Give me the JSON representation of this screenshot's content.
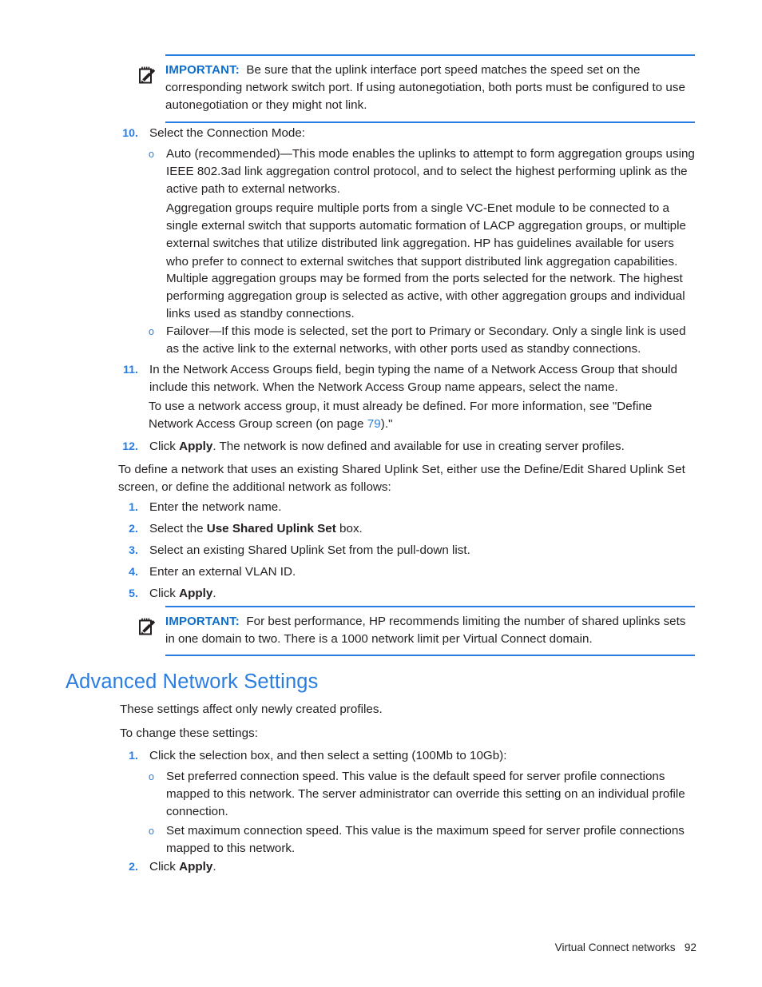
{
  "page": {
    "footer_text": "Virtual Connect networks",
    "footer_page_number": "92"
  },
  "colors": {
    "accent_blue": "#2a7de1",
    "important_blue": "#0d6ecd",
    "body_black": "#231f20"
  },
  "notes": [
    {
      "icon": "note-pencil-icon",
      "label": "IMPORTANT:",
      "text": "Be sure that the uplink interface port speed matches the speed set on the corresponding network switch port. If using autonegotiation, both ports must be configured to use autonegotiation or they might not link."
    },
    {
      "icon": "note-pencil-icon",
      "label": "IMPORTANT:",
      "text": "For best performance, HP recommends limiting the number of shared uplinks sets in one domain to two. There is a 1000 network limit per Virtual Connect domain."
    }
  ],
  "steps": {
    "item10_num": "10.",
    "item10_text": "Select the Connection Mode:",
    "item10_sub": [
      {
        "bullet": "o",
        "text": "Auto (recommended)—This mode enables the uplinks to attempt to form aggregation groups using IEEE 802.3ad link aggregation control protocol, and to select the highest performing uplink as the active path to external networks."
      },
      {
        "bullet": "o",
        "text": "Failover—If this mode is selected, set the port to Primary or Secondary. Only a single link is used as the active link to the external networks, with other ports used as standby connections."
      }
    ],
    "item10_para1": "Aggregation groups require multiple ports from a single VC-Enet module to be connected to a single external switch that supports automatic formation of LACP aggregation groups, or multiple external switches that utilize distributed link aggregation. HP has guidelines available for users who prefer to connect to external switches that support distributed link aggregation capabilities.",
    "item10_para2": "Multiple aggregation groups may be formed from the ports selected for the network. The highest performing aggregation group is selected as active, with other aggregation groups and individual links used as standby connections.",
    "item11_num": "11.",
    "item11_text": "In the Network Access Groups field, begin typing the name of a Network Access Group that should include this network. When the Network Access Group name appears, select the name.",
    "item11_para": {
      "before": "To use a network access group, it must already be defined. For more information, see \"Define Network Access Group screen (on page ",
      "link": "79",
      "after": ").\""
    },
    "item12_num": "12.",
    "item12_text": {
      "before": "Click ",
      "bold": "Apply",
      "after": ". The network is now defined and available for use in creating server profiles."
    }
  },
  "intro_paragraph": "To define a network that uses an existing Shared Uplink Set, either use the Define/Edit Shared Uplink Set screen, or define the additional network as follows:",
  "sul_steps": [
    {
      "num": "1.",
      "before": "Enter the network name.",
      "bold": "",
      "after": ""
    },
    {
      "num": "2.",
      "before": "Select the ",
      "bold": "Use Shared Uplink Set",
      "after": " box."
    },
    {
      "num": "3.",
      "before": "Select an existing Shared Uplink Set from the pull-down list.",
      "bold": "",
      "after": ""
    },
    {
      "num": "4.",
      "before": "Enter an external VLAN ID.",
      "bold": "",
      "after": ""
    },
    {
      "num": "5.",
      "before": "Click ",
      "bold": "Apply",
      "after": "."
    }
  ],
  "advanced": {
    "heading": "Advanced Network Settings",
    "para1": "These settings affect only newly created profiles.",
    "para2": "To change these settings:",
    "step1_num": "1.",
    "step1_text": "Click the selection box, and then select a setting (100Mb to 10Gb):",
    "step1_sub": [
      {
        "bullet": "o",
        "text": "Set preferred connection speed. This value is the default speed for server profile connections mapped to this network. The server administrator can override this setting on an individual profile connection."
      },
      {
        "bullet": "o",
        "text": "Set maximum connection speed. This value is the maximum speed for server profile connections mapped to this network."
      }
    ],
    "step2_num": "2.",
    "step2_text": {
      "before": "Click ",
      "bold": "Apply",
      "after": "."
    }
  }
}
